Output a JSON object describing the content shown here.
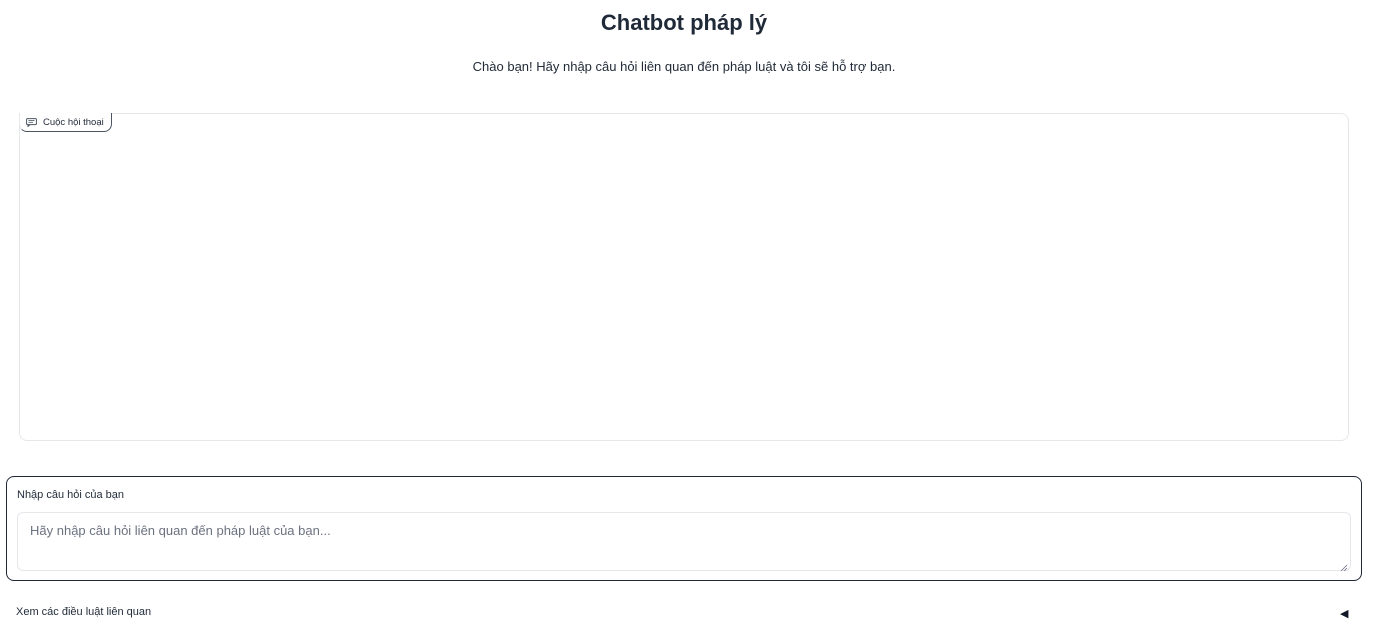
{
  "header": {
    "title": "Chatbot pháp lý",
    "subtitle": "Chào bạn! Hãy nhập câu hỏi liên quan đến pháp luật và tôi sẽ hỗ trợ bạn."
  },
  "chatbot": {
    "label": "Cuộc hội thoại",
    "icon": "chat-icon"
  },
  "question_input": {
    "label": "Nhập câu hỏi của bạn",
    "placeholder": "Hãy nhập câu hỏi liên quan đến pháp luật của bạn...",
    "value": ""
  },
  "accordion": {
    "label": "Xem các điều luật liên quan",
    "arrow": "◀"
  }
}
